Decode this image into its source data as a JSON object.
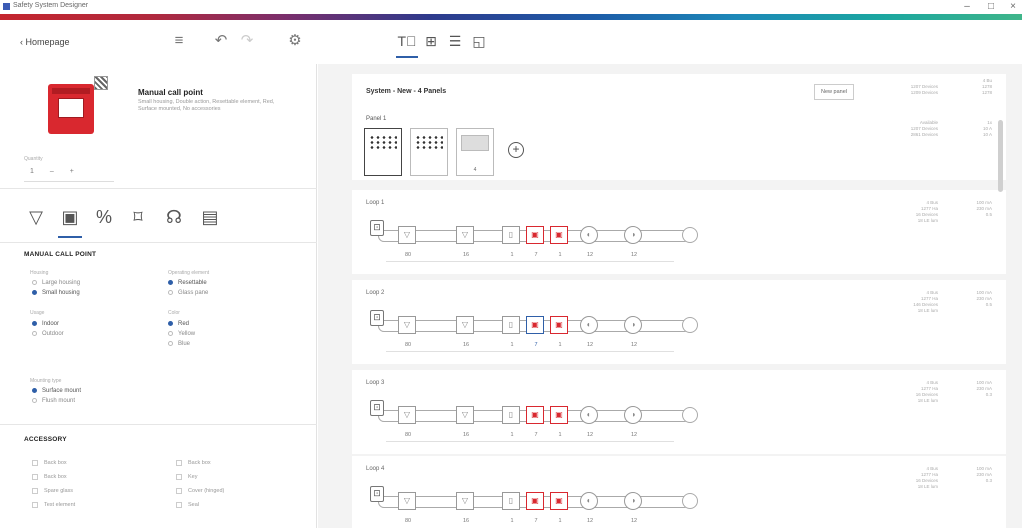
{
  "window": {
    "title": "Safety System Designer",
    "minimize": "–",
    "maximize": "□",
    "close": "×"
  },
  "toolbar": {
    "back_label": "‹ Homepage",
    "menu_glyph": "≡",
    "undo_glyph": "↶",
    "redo_glyph": "↷",
    "settings_glyph": "⚙",
    "tabs": [
      {
        "glyph": "T⃞",
        "active": true
      },
      {
        "glyph": "⊞",
        "active": false
      },
      {
        "glyph": "☰",
        "active": false
      },
      {
        "glyph": "◱",
        "active": false
      }
    ]
  },
  "product": {
    "title": "Manual call point",
    "description": "Small housing, Double action, Resettable element, Red, Surface mounted, No accessories"
  },
  "quantity": {
    "label": "Quantity",
    "value": "1",
    "minus": "–",
    "plus": "+"
  },
  "categories": [
    "smoke-detector-icon",
    "call-point-icon",
    "percent-icon",
    "module-icon",
    "sounder-icon",
    "beacon-icon"
  ],
  "category_glyphs": [
    "▽",
    "▣",
    "%",
    "⌑",
    "☊",
    "▤"
  ],
  "manual_call_point": {
    "heading": "MANUAL CALL POINT",
    "housing": {
      "label": "Housing",
      "options": [
        {
          "label": "Large housing",
          "selected": false
        },
        {
          "label": "Small housing",
          "selected": true
        }
      ]
    },
    "element": {
      "label": "Operating element",
      "options": [
        {
          "label": "Resettable",
          "selected": true
        },
        {
          "label": "Glass pane",
          "selected": false
        }
      ]
    },
    "usage": {
      "label": "Usage",
      "options": [
        {
          "label": "Indoor",
          "selected": true
        },
        {
          "label": "Outdoor",
          "selected": false
        }
      ]
    },
    "color": {
      "label": "Color",
      "options": [
        {
          "label": "Red",
          "selected": true
        },
        {
          "label": "Yellow",
          "selected": false
        },
        {
          "label": "Blue",
          "selected": false
        }
      ]
    },
    "mounting": {
      "label": "Mounting type",
      "options": [
        {
          "label": "Surface mount",
          "selected": true
        },
        {
          "label": "Flush mount",
          "selected": false
        }
      ]
    }
  },
  "accessory": {
    "heading": "ACCESSORY",
    "col1": [
      "Back box",
      "Back box",
      "Spare glass",
      "Test element"
    ],
    "col2": [
      "Back box",
      "Key",
      "Cover (hinged)",
      "Seal"
    ]
  },
  "system": {
    "title": "System - New - 4 Panels",
    "new_panel_button": "New panel",
    "stats_left": [
      "1207 Devices",
      "1209 Devices"
    ],
    "stats_right": [
      "4 Bu",
      "1278",
      "1278"
    ],
    "panel_label": "Panel 1",
    "panel_count": "4",
    "panel_stats_left": [
      "Available",
      "1207 Devices",
      "2861 Devices"
    ],
    "panel_stats_right": [
      "1x",
      "10 A",
      "10 A"
    ],
    "add_glyph": "+"
  },
  "loops": [
    {
      "label": "Loop 1",
      "counts": [
        "80",
        "16",
        "1",
        "7",
        "1",
        "12",
        "12"
      ],
      "stats_left": [
        "4 Bus",
        "1277 Ha",
        "16 Devices",
        "18 LE lum"
      ],
      "stats_right": [
        "100 mA",
        "230 mA",
        "0.5"
      ]
    },
    {
      "label": "Loop 2",
      "counts": [
        "80",
        "16",
        "1",
        "7",
        "1",
        "12",
        "12"
      ],
      "stats_left": [
        "4 Bus",
        "1277 Ha",
        "146 Devices",
        "18 LE lum"
      ],
      "stats_right": [
        "100 mA",
        "230 mA",
        "0.5"
      ]
    },
    {
      "label": "Loop 3",
      "counts": [
        "80",
        "16",
        "1",
        "7",
        "1",
        "12",
        "12"
      ],
      "stats_left": [
        "4 Bus",
        "1277 Ha",
        "16 Devices",
        "18 LE lum"
      ],
      "stats_right": [
        "100 mA",
        "230 mA",
        "0.3"
      ]
    },
    {
      "label": "Loop 4",
      "counts": [
        "80",
        "16",
        "1",
        "7",
        "1",
        "12",
        "12"
      ],
      "stats_left": [
        "4 Bus",
        "1277 Ha",
        "16 Devices",
        "18 LE lum"
      ],
      "stats_right": [
        "100 mA",
        "230 mA",
        "0.3"
      ]
    }
  ],
  "colors": {
    "accent": "#2f5fa8",
    "device_red": "#d9282f"
  }
}
